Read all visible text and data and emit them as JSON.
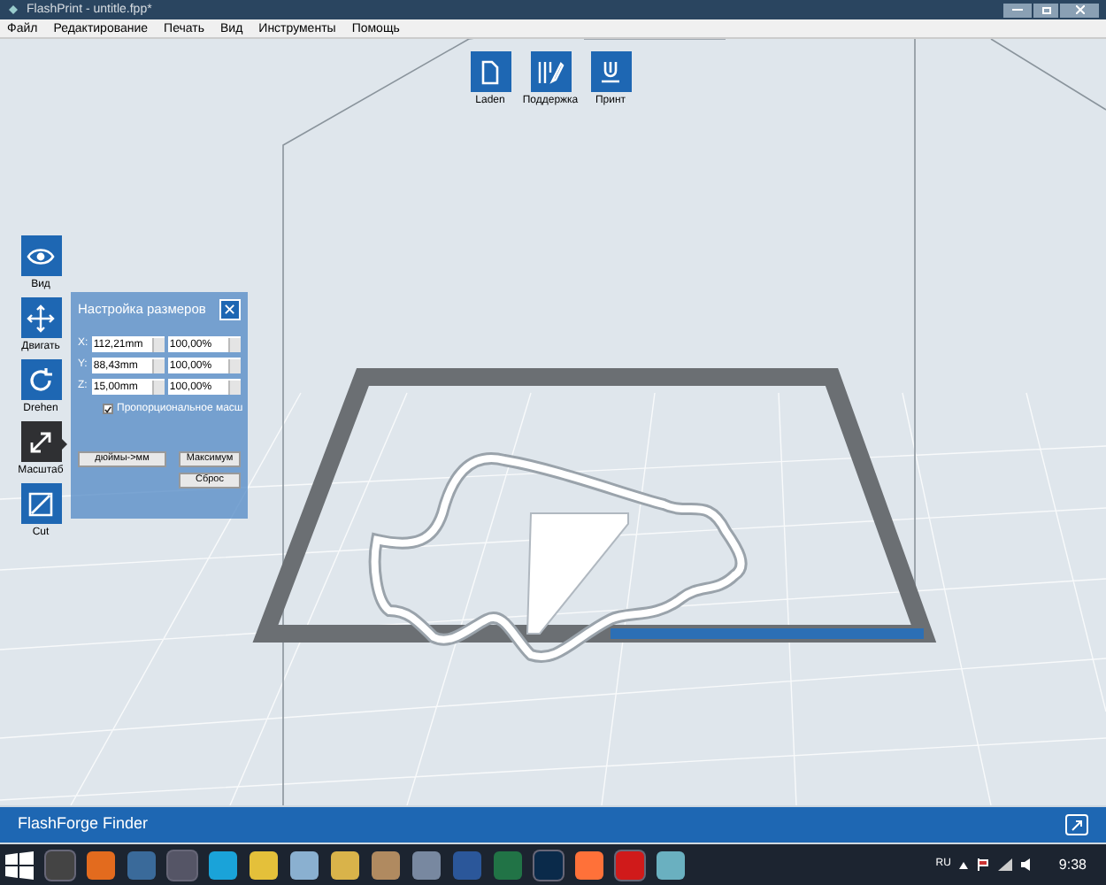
{
  "window": {
    "title": "FlashPrint - untitle.fpp*"
  },
  "menu": [
    "Файл",
    "Редактирование",
    "Печать",
    "Вид",
    "Инструменты",
    "Помощь"
  ],
  "top_toolbar": [
    {
      "kind": "load",
      "label": "Laden"
    },
    {
      "kind": "support",
      "label": "Поддержка"
    },
    {
      "kind": "print",
      "label": "Принт"
    }
  ],
  "left_toolbar": [
    {
      "kind": "view",
      "label": "Вид",
      "selected": false
    },
    {
      "kind": "move",
      "label": "Двигать",
      "selected": false
    },
    {
      "kind": "rotate",
      "label": "Drehen",
      "selected": false
    },
    {
      "kind": "scale",
      "label": "Масштаб",
      "selected": true
    },
    {
      "kind": "cut",
      "label": "Cut",
      "selected": false
    }
  ],
  "scale_panel": {
    "title": "Настройка размеров",
    "close": "✕",
    "rows": [
      {
        "axis": "X:",
        "size": "112,21mm",
        "percent": "100,00%"
      },
      {
        "axis": "Y:",
        "size": "88,43mm",
        "percent": "100,00%"
      },
      {
        "axis": "Z:",
        "size": "15,00mm",
        "percent": "100,00%"
      }
    ],
    "proportional": {
      "label": "Пропорциональное масш",
      "checked": true
    },
    "buttons": [
      "дюймы->мм",
      "Максимум",
      "Сброс"
    ]
  },
  "status_bar": {
    "text": "FlashForge Finder"
  },
  "taskbar": {
    "language": "RU",
    "time": "9:38"
  }
}
